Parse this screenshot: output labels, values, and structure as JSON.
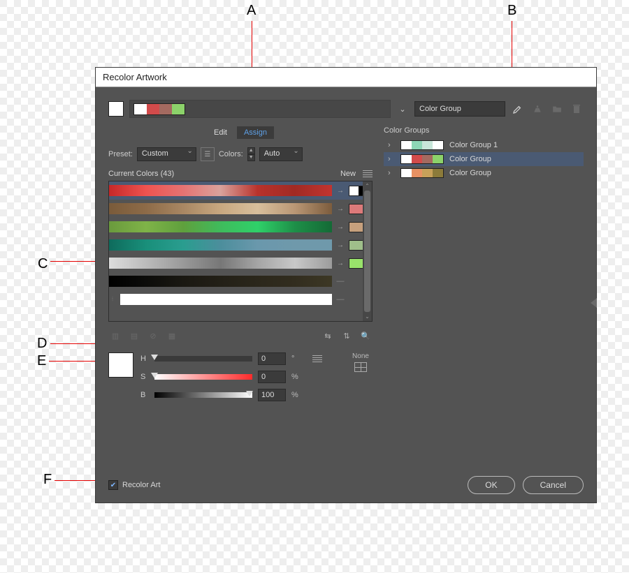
{
  "window": {
    "title": "Recolor Artwork"
  },
  "top": {
    "group_name": "Color Group",
    "swatches": [
      "#ffffff",
      "#d24b4b",
      "#a46a60",
      "#8cd26a"
    ]
  },
  "tabs": {
    "edit": "Edit",
    "assign": "Assign",
    "active": "assign"
  },
  "preset": {
    "label": "Preset:",
    "value": "Custom",
    "colors_label": "Colors:",
    "colors_value": "Auto"
  },
  "current": {
    "label": "Current Colors (43)",
    "new_label": "New",
    "rows": [
      {
        "grad": "linear-gradient(90deg,#c62828,#ef5350,#e57373,#d9a29c,#b9322c,#a12a24,#c23430)",
        "new": [
          "#fff",
          "#000"
        ],
        "selected": true,
        "arrow": true
      },
      {
        "grad": "linear-gradient(90deg,#7a5b3a,#8d6b48,#a98763,#c8a880,#d8bf9c,#b99775,#7c5c3d)",
        "new": [
          "#dd7a7a"
        ],
        "arrow": true
      },
      {
        "grad": "linear-gradient(90deg,#6a9a3d,#7fb348,#5fa03d,#3fbb5c,#2fd169,#1e8f48,#146a36)",
        "new": [
          "#c6a07d"
        ],
        "arrow": true
      },
      {
        "grad": "linear-gradient(90deg,#0e6b5c,#198f7a,#2a9d8f,#4c8e9c,#6a98ac,#6f99ab,#6f99ab)",
        "new": [
          "#9fbf8a"
        ],
        "arrow": true
      },
      {
        "grad": "linear-gradient(90deg,#ddd,#bbb,#999,#777,#a5a5a5,#c8c8c8,#9c9c9c)",
        "new": [
          "#99e36b"
        ],
        "arrow": true
      },
      {
        "grad": "linear-gradient(90deg,#000,#0c0c0a,#1a1812,#232017,#2b271b,#322d1f,#3d3825)",
        "new": null,
        "arrow": false
      },
      {
        "grad": "#ffffff",
        "new": null,
        "arrow": false,
        "edge": true
      }
    ]
  },
  "hsb": {
    "h_label": "H",
    "h_value": "0",
    "h_unit": "°",
    "s_label": "S",
    "s_value": "0",
    "s_unit": "%",
    "b_label": "B",
    "b_value": "100",
    "b_unit": "%",
    "none_label": "None"
  },
  "groups": {
    "title": "Color Groups",
    "items": [
      {
        "swatches": [
          "#ffffff",
          "#8dd6b6",
          "#c7e6d9",
          "#ffffff"
        ],
        "label": "Color Group 1",
        "selected": false
      },
      {
        "swatches": [
          "#ffffff",
          "#d24b4b",
          "#a46a60",
          "#8cd26a"
        ],
        "label": "Color Group",
        "selected": true
      },
      {
        "swatches": [
          "#ffffff",
          "#e79163",
          "#c8a15a",
          "#8c7b3a"
        ],
        "label": "Color Group",
        "selected": false
      }
    ]
  },
  "footer": {
    "checkbox_label": "Recolor Art",
    "checkbox_checked": true,
    "ok": "OK",
    "cancel": "Cancel"
  },
  "callouts": {
    "A": "A",
    "B": "B",
    "C": "C",
    "D": "D",
    "E": "E",
    "F": "F"
  }
}
